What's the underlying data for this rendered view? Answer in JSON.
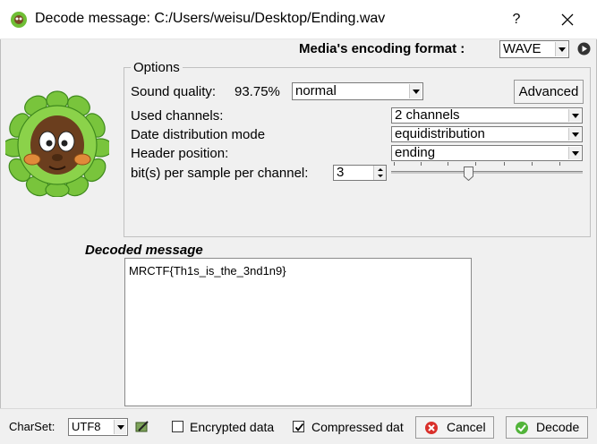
{
  "window": {
    "title": "Decode message: C:/Users/weisu/Desktop/Ending.wav",
    "help": "?",
    "close": "close"
  },
  "format": {
    "label": "Media's encoding format :",
    "value": "WAVE"
  },
  "options": {
    "group_title": "Options",
    "sound_quality_label": "Sound quality:",
    "sound_quality_value": "93.75%",
    "quality_select": "normal",
    "advanced_label": "Advanced",
    "channels_label": "Used channels:",
    "channels_value": "2 channels",
    "distribution_label": "Date distribution mode",
    "distribution_value": "equidistribution",
    "header_label": "Header position:",
    "header_value": "ending",
    "bits_label": "bit(s) per sample per channel:",
    "bits_value": "3"
  },
  "decoded": {
    "label": "Decoded message",
    "text": "MRCTF{Th1s_is_the_3nd1n9}"
  },
  "footer": {
    "charset_label": "CharSet:",
    "charset_value": "UTF8",
    "encrypted_label": "Encrypted data",
    "encrypted_checked": false,
    "compressed_label": "Compressed dat",
    "compressed_checked": true,
    "cancel_label": "Cancel",
    "decode_label": "Decode"
  },
  "colors": {
    "cancel_icon": "#d9302b",
    "decode_icon": "#52b43a",
    "leaf_green": "#74c23a"
  }
}
